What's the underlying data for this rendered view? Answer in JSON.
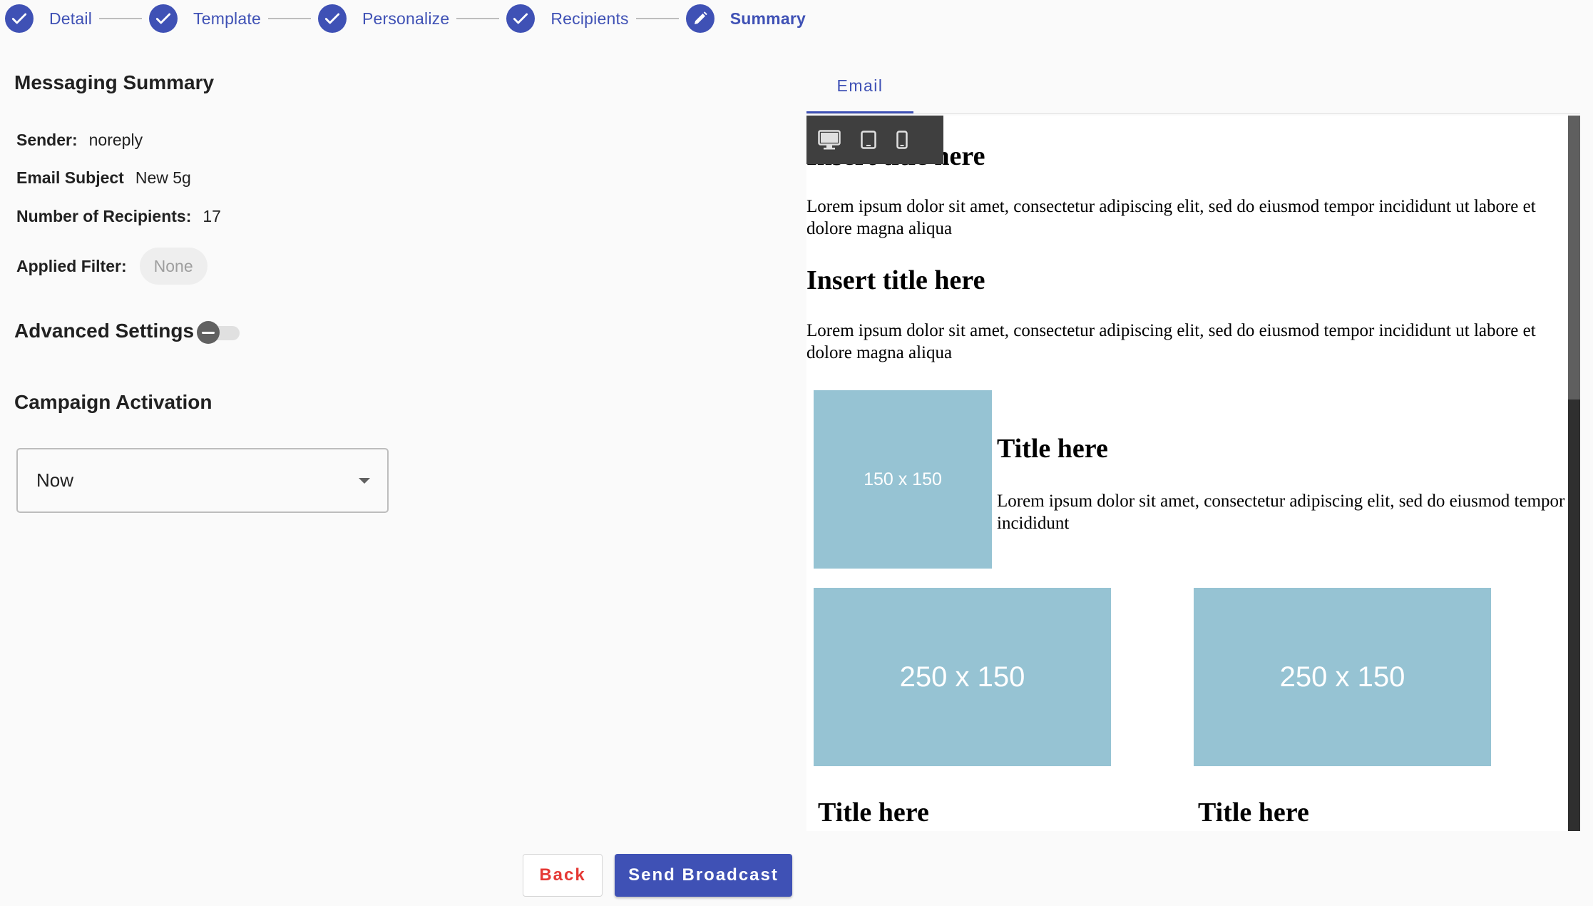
{
  "stepper": {
    "steps": [
      {
        "label": "Detail",
        "state": "complete"
      },
      {
        "label": "Template",
        "state": "complete"
      },
      {
        "label": "Personalize",
        "state": "complete"
      },
      {
        "label": "Recipients",
        "state": "complete"
      },
      {
        "label": "Summary",
        "state": "active"
      }
    ]
  },
  "summary": {
    "title": "Messaging Summary",
    "sender_label": "Sender:",
    "sender_value": "noreply",
    "subject_label": "Email Subject",
    "subject_value": "New 5g",
    "recipients_label": "Number of Recipients:",
    "recipients_value": "17",
    "filter_label": "Applied Filter:",
    "filter_value": "None"
  },
  "advanced": {
    "label": "Advanced Settings",
    "enabled": false
  },
  "activation": {
    "title": "Campaign Activation",
    "selected": "Now"
  },
  "buttons": {
    "back": "Back",
    "send": "Send Broadcast"
  },
  "preview": {
    "tab": "Email",
    "email": {
      "title1": "Insert title here",
      "paragraph1": "Lorem ipsum dolor sit amet, consectetur adipiscing elit, sed do eiusmod tempor incididunt ut labore et dolore magna aliqua",
      "title2": "Insert title here",
      "paragraph2": "Lorem ipsum dolor sit amet, consectetur adipiscing elit, sed do eiusmod tempor incididunt ut labore et dolore magna aliqua",
      "side_image": "150 x 150",
      "side_title": "Title here",
      "side_text": "Lorem ipsum dolor sit amet, consectetur adipiscing elit, sed do eiusmod tempor incididunt",
      "image_left": "250 x 150",
      "image_right": "250 x 150",
      "title_left": "Title here",
      "title_right": "Title here"
    }
  },
  "colors": {
    "primary": "#3f51b5",
    "danger": "#e53935",
    "placeholder": "#96c3d3"
  },
  "icons": [
    "check-icon",
    "pencil-icon",
    "desktop-icon",
    "tablet-icon",
    "mobile-icon",
    "caret-down-icon"
  ]
}
